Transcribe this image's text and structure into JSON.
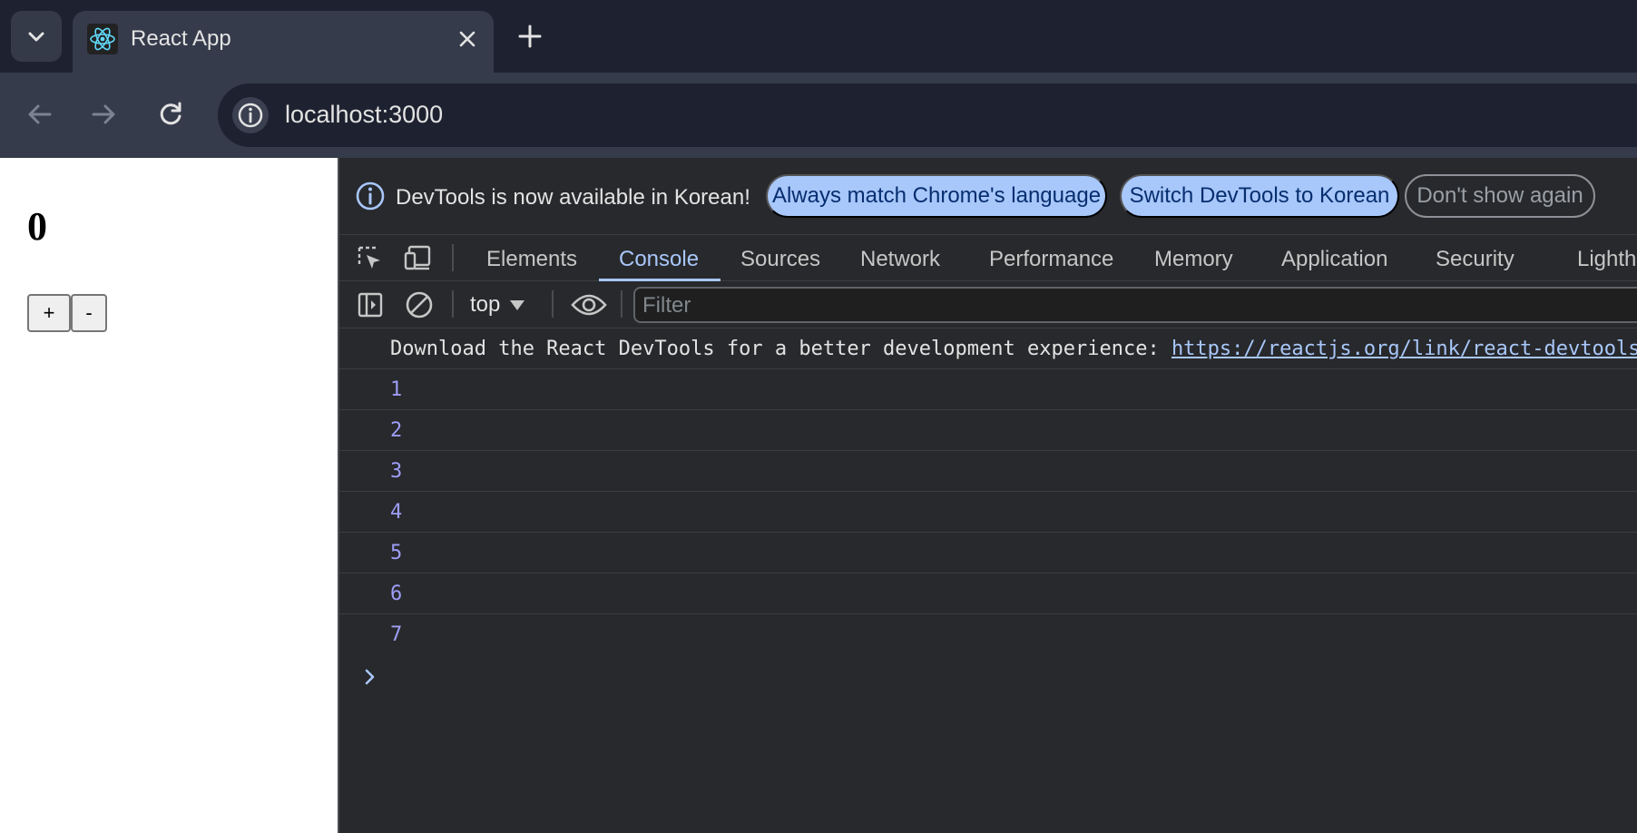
{
  "browser": {
    "tab_title": "React App",
    "url": "localhost:3000",
    "icons": {
      "tab_search": "chevron-down-icon",
      "favicon": "react-logo-icon",
      "close": "close-icon",
      "new_tab": "plus-icon",
      "back": "arrow-left-icon",
      "forward": "arrow-right-icon",
      "reload": "reload-icon",
      "site_info": "info-icon"
    }
  },
  "page": {
    "counter": "0",
    "plus_label": "+",
    "minus_label": "-"
  },
  "devtools": {
    "infobar": {
      "message": "DevTools is now available in Korean!",
      "always_match": "Always match Chrome's language",
      "switch": "Switch DevTools to Korean",
      "dont_show": "Don't show again"
    },
    "tabs": [
      {
        "label": "Elements"
      },
      {
        "label": "Console"
      },
      {
        "label": "Sources"
      },
      {
        "label": "Network"
      },
      {
        "label": "Performance"
      },
      {
        "label": "Memory"
      },
      {
        "label": "Application"
      },
      {
        "label": "Security"
      },
      {
        "label": "Lighth"
      }
    ],
    "active_tab": "Console",
    "console_toolbar": {
      "context": "top",
      "filter_placeholder": "Filter"
    },
    "console": {
      "message_prefix": "Download the React DevTools for a better development experience: ",
      "message_link": "https://reactjs.org/link/react-devtools",
      "logs": [
        "1",
        "2",
        "3",
        "4",
        "5",
        "6",
        "7"
      ]
    },
    "colors": {
      "accent": "#a8c7fa",
      "log_number": "#9e9ef9",
      "background": "#28292c"
    }
  }
}
